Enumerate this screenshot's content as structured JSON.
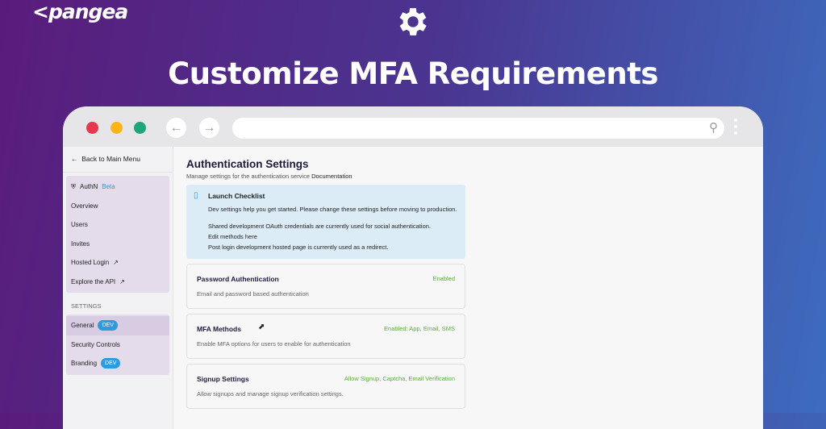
{
  "brand": {
    "logo": "<pangea"
  },
  "headline": "Customize MFA Requirements",
  "colors": {
    "accent": "#2d9be0",
    "enabled": "#5aab3a"
  },
  "sidebar": {
    "back": "Back to Main Menu",
    "service": "AuthN",
    "service_badge": "Beta",
    "items": [
      "Overview",
      "Users",
      "Invites",
      "Hosted Login",
      "Explore the API"
    ],
    "settings_label": "SETTINGS",
    "settings": [
      {
        "label": "General",
        "badge": "DEV"
      },
      {
        "label": "Security Controls"
      },
      {
        "label": "Branding",
        "badge": "DEV"
      }
    ]
  },
  "main": {
    "title": "Authentication Settings",
    "subtitle": "Manage settings for the authentication service",
    "doc_link": "Documentation",
    "checklist": {
      "title": "Launch Checklist",
      "p1": "Dev settings help you get started. Please change these settings before moving to production.",
      "p2": "Shared development OAuth credentials are currently used for social authentication.",
      "link": "Edit methods here",
      "p3": "Post login development hosted page is currently used as a redirect."
    },
    "cards": [
      {
        "title": "Password Authentication",
        "desc": "Email and password based authentication",
        "status": "Enabled"
      },
      {
        "title": "MFA Methods",
        "desc": "Enable MFA options for users to enable for authentication",
        "status": "Enabled: App, Email, SMS"
      },
      {
        "title": "Signup Settings",
        "desc": "Allow signups and manage signup verification settings.",
        "status": "Allow Signup, Captcha, Email Verification"
      }
    ]
  }
}
